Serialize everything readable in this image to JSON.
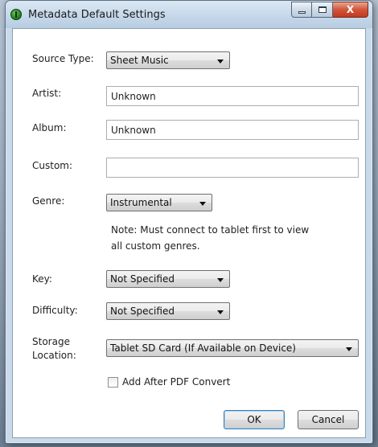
{
  "window": {
    "title": "Metadata Default Settings",
    "icon": "app-green-icon"
  },
  "caption_buttons": {
    "close_glyph": "X"
  },
  "form": {
    "source_type": {
      "label": "Source Type:",
      "value": "Sheet Music"
    },
    "artist": {
      "label": "Artist:",
      "value": "Unknown"
    },
    "album": {
      "label": "Album:",
      "value": "Unknown"
    },
    "custom": {
      "label": "Custom:",
      "value": ""
    },
    "genre": {
      "label": "Genre:",
      "value": "Instrumental"
    },
    "genre_note_line1": "Note: Must connect to tablet first to view",
    "genre_note_line2": "all custom genres.",
    "key": {
      "label": "Key:",
      "value": "Not Specified"
    },
    "difficulty": {
      "label": "Difficulty:",
      "value": "Not Specified"
    },
    "storage": {
      "label_line1": "Storage",
      "label_line2": "Location:",
      "value": "Tablet SD Card (If Available on Device)"
    },
    "add_after_pdf": {
      "label": "Add After PDF Convert",
      "checked": false
    }
  },
  "buttons": {
    "ok": "OK",
    "cancel": "Cancel"
  }
}
